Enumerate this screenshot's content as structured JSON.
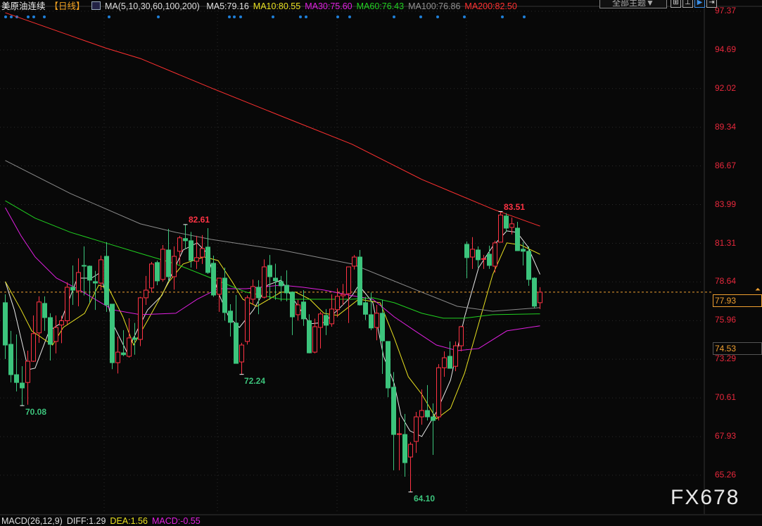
{
  "header": {
    "title": "美原油连续",
    "period": "【日线】",
    "ma_params": "MA(5,10,30,60,100,200)",
    "ma_values": [
      {
        "label": "MA5:79.16",
        "color": "#e0e0e0"
      },
      {
        "label": "MA10:80.55",
        "color": "#e8e020"
      },
      {
        "label": "MA30:75.60",
        "color": "#e020e0"
      },
      {
        "label": "MA60:76.43",
        "color": "#20d020"
      },
      {
        "label": "MA100:76.86",
        "color": "#909090"
      },
      {
        "label": "MA200:82.50",
        "color": "#ff3030"
      }
    ],
    "theme_button": "全部主题▼",
    "tools": [
      "⊞",
      "⊥",
      "▶",
      "⇥"
    ]
  },
  "price_axis": {
    "ticks": [
      "97.37",
      "94.69",
      "92.02",
      "89.34",
      "86.67",
      "83.99",
      "81.31",
      "78.64",
      "75.96",
      "73.29",
      "70.61",
      "67.93",
      "65.26"
    ],
    "current_price": "77.93",
    "reference_price": "74.53"
  },
  "annotations": {
    "low1": "70.08",
    "low2": "72.24",
    "low3": "64.10",
    "high1": "82.61",
    "high2": "83.51"
  },
  "watermark": "FX678",
  "macd": {
    "params": "MACD(26,12,9)",
    "diff": "DIFF:1.29",
    "dea": "DEA:1.56",
    "macd": "MACD:-0.55"
  },
  "colors": {
    "up": "#ff3344",
    "down": "#3cc47c",
    "background": "#080808",
    "axis_label": "#e8283c",
    "current": "#f0a030"
  },
  "chart_data": {
    "type": "candlestick",
    "title": "美原油连续【日线】",
    "ylim": [
      64.0,
      97.37
    ],
    "ohlc": [
      [
        77.2,
        77.78,
        73.3,
        74.27
      ],
      [
        74.32,
        75.25,
        71.68,
        72.22
      ],
      [
        72.22,
        75.0,
        71.06,
        71.68
      ],
      [
        71.64,
        72.81,
        70.08,
        71.3
      ],
      [
        71.68,
        73.88,
        70.14,
        73.15
      ],
      [
        73.15,
        76.32,
        73.1,
        75.06
      ],
      [
        75.11,
        77.64,
        74.42,
        77.25
      ],
      [
        77.15,
        77.64,
        75.25,
        76.17
      ],
      [
        76.17,
        76.47,
        73.2,
        74.32
      ],
      [
        74.52,
        76.32,
        73.69,
        75.49
      ],
      [
        75.66,
        76.3,
        74.4,
        75.95
      ],
      [
        75.95,
        78.6,
        75.7,
        78.27
      ],
      [
        78.27,
        79.78,
        77.05,
        78.07
      ],
      [
        78.02,
        80.27,
        76.95,
        79.29
      ],
      [
        79.78,
        81.1,
        77.7,
        79.73
      ],
      [
        79.73,
        79.78,
        77.2,
        78.76
      ],
      [
        78.66,
        79.4,
        76.7,
        78.56
      ],
      [
        78.56,
        80.46,
        78.07,
        80.17
      ],
      [
        80.41,
        81.39,
        76.57,
        77.05
      ],
      [
        77.1,
        77.1,
        72.6,
        73.05
      ],
      [
        73.05,
        74.85,
        72.3,
        73.78
      ],
      [
        73.73,
        75.3,
        73.5,
        73.6
      ],
      [
        73.49,
        76.12,
        73.4,
        74.76
      ],
      [
        74.76,
        75.8,
        73.6,
        74.66
      ],
      [
        74.66,
        77.6,
        74.2,
        77.54
      ],
      [
        77.54,
        79.05,
        77.05,
        78.07
      ],
      [
        78.22,
        80.02,
        77.9,
        79.88
      ],
      [
        79.98,
        80.12,
        78.41,
        78.71
      ],
      [
        78.81,
        81.19,
        78.66,
        80.9
      ],
      [
        80.85,
        82.31,
        78.66,
        79.0
      ],
      [
        79.0,
        81.1,
        78.1,
        80.41
      ],
      [
        80.76,
        81.83,
        79.83,
        81.69
      ],
      [
        81.64,
        82.61,
        80.9,
        81.49
      ],
      [
        81.49,
        82.1,
        79.63,
        80.12
      ],
      [
        80.07,
        81.83,
        79.54,
        80.32
      ],
      [
        80.36,
        81.88,
        79.88,
        80.95
      ],
      [
        81.05,
        82.36,
        79.2,
        79.29
      ],
      [
        79.93,
        80.46,
        77.6,
        77.73
      ],
      [
        77.78,
        78.9,
        76.57,
        78.9
      ],
      [
        78.9,
        79.63,
        75.96,
        76.52
      ],
      [
        76.62,
        77.1,
        74.86,
        75.84
      ],
      [
        75.79,
        77.73,
        73.0,
        73.0
      ],
      [
        73.1,
        74.42,
        72.24,
        74.27
      ],
      [
        74.52,
        77.7,
        74.3,
        77.54
      ],
      [
        77.44,
        78.8,
        77.05,
        78.32
      ],
      [
        78.27,
        78.76,
        76.4,
        77.54
      ],
      [
        77.58,
        80.2,
        77.5,
        79.68
      ],
      [
        79.78,
        80.5,
        77.4,
        79.0
      ],
      [
        78.9,
        79.9,
        77.4,
        78.71
      ],
      [
        78.66,
        79.05,
        77.3,
        78.37
      ],
      [
        78.41,
        79.44,
        77.3,
        77.88
      ],
      [
        77.93,
        77.98,
        74.96,
        76.22
      ],
      [
        76.37,
        77.4,
        75.96,
        77.05
      ],
      [
        77.25,
        78.07,
        75.6,
        76.08
      ],
      [
        75.96,
        76.4,
        73.7,
        73.73
      ],
      [
        73.78,
        76.1,
        73.7,
        75.54
      ],
      [
        75.49,
        76.57,
        74.03,
        76.42
      ],
      [
        76.32,
        76.76,
        74.96,
        75.64
      ],
      [
        75.74,
        77.78,
        75.54,
        76.76
      ],
      [
        76.72,
        78.2,
        76.2,
        77.64
      ],
      [
        77.68,
        78.5,
        77.05,
        77.78
      ],
      [
        77.83,
        79.68,
        75.8,
        79.68
      ],
      [
        79.73,
        80.5,
        79.5,
        80.36
      ],
      [
        80.36,
        80.85,
        77.0,
        77.05
      ],
      [
        77.2,
        77.6,
        76.0,
        76.4
      ],
      [
        76.37,
        77.9,
        75.3,
        75.45
      ],
      [
        75.49,
        77.05,
        74.6,
        76.47
      ],
      [
        76.47,
        77.4,
        72.27,
        74.56
      ],
      [
        74.52,
        74.52,
        70.66,
        71.3
      ],
      [
        71.35,
        72.4,
        65.6,
        68.08
      ],
      [
        68.08,
        69.25,
        65.6,
        68.13
      ],
      [
        68.08,
        69.5,
        65.16,
        66.13
      ],
      [
        66.52,
        67.56,
        64.1,
        67.4
      ],
      [
        67.6,
        69.64,
        66.81,
        69.3
      ],
      [
        69.3,
        71.2,
        68.76,
        69.74
      ],
      [
        69.74,
        71.5,
        69.05,
        69.3
      ],
      [
        69.3,
        70.23,
        66.67,
        69.05
      ],
      [
        69.3,
        72.95,
        69.05,
        72.7
      ],
      [
        72.7,
        73.83,
        72.07,
        73.39
      ],
      [
        73.49,
        74.52,
        72.66,
        72.66
      ],
      [
        72.8,
        74.52,
        72.46,
        74.22
      ],
      [
        74.22,
        75.6,
        73.83,
        75.54
      ],
      [
        81.24,
        81.44,
        78.9,
        80.32
      ],
      [
        80.36,
        81.74,
        79.54,
        80.9
      ],
      [
        80.85,
        81.1,
        79.63,
        80.17
      ],
      [
        80.2,
        80.5,
        79.54,
        80.25
      ],
      [
        80.56,
        81.15,
        79.54,
        79.78
      ],
      [
        79.73,
        81.49,
        79.29,
        81.34
      ],
      [
        81.39,
        83.51,
        81.39,
        83.27
      ],
      [
        83.2,
        83.4,
        82.1,
        82.36
      ],
      [
        82.41,
        83.1,
        81.93,
        82.66
      ],
      [
        82.36,
        82.8,
        80.8,
        80.8
      ],
      [
        80.9,
        81.4,
        79.78,
        80.76
      ],
      [
        80.76,
        81.1,
        78.37,
        78.81
      ],
      [
        78.9,
        78.96,
        76.8,
        76.96
      ],
      [
        77.2,
        78.27,
        76.76,
        77.93
      ]
    ],
    "ohlc_fields": [
      "open",
      "high",
      "low",
      "close"
    ],
    "moving_averages": [
      {
        "name": "MA5",
        "color": "#e8e8e8",
        "points": [
          [
            0,
            78.66
          ],
          [
            1.6,
            76.71
          ],
          [
            4.1,
            72.57
          ],
          [
            5.3,
            72.67
          ],
          [
            7.8,
            75.25
          ],
          [
            9.7,
            75.74
          ],
          [
            12.8,
            78.9
          ],
          [
            15.3,
            78.9
          ],
          [
            16.9,
            79.29
          ],
          [
            19.1,
            75.74
          ],
          [
            21.6,
            73.79
          ],
          [
            23.4,
            75.25
          ],
          [
            25.3,
            76.71
          ],
          [
            27.8,
            77.69
          ],
          [
            31.6,
            80.85
          ],
          [
            34.1,
            81.34
          ],
          [
            35.9,
            80.61
          ],
          [
            37.8,
            77.93
          ],
          [
            39.7,
            76.22
          ],
          [
            41.6,
            75.49
          ],
          [
            44.1,
            76.71
          ],
          [
            46.6,
            78.42
          ],
          [
            49,
            78.76
          ],
          [
            51.6,
            77.2
          ],
          [
            54.1,
            75.74
          ],
          [
            56.6,
            75.83
          ],
          [
            59.1,
            76.71
          ],
          [
            61.6,
            77.69
          ],
          [
            62.8,
            78.42
          ],
          [
            65.3,
            77.2
          ],
          [
            67.2,
            73.5
          ],
          [
            69.1,
            71.59
          ],
          [
            70.3,
            69.4
          ],
          [
            71.9,
            68.33
          ],
          [
            74,
            67.94
          ],
          [
            76.6,
            69.64
          ],
          [
            79.1,
            71.84
          ],
          [
            81.6,
            76.22
          ],
          [
            84.1,
            79.63
          ],
          [
            86.6,
            81.1
          ],
          [
            89.1,
            82.17
          ],
          [
            90.9,
            82.07
          ],
          [
            92.8,
            81.1
          ],
          [
            95,
            79.16
          ]
        ]
      },
      {
        "name": "MA10",
        "color": "#e8e020",
        "points": [
          [
            0,
            78.66
          ],
          [
            2.8,
            76.71
          ],
          [
            4.7,
            75.25
          ],
          [
            8.4,
            74.27
          ],
          [
            10.3,
            75.49
          ],
          [
            14.1,
            76.47
          ],
          [
            16.6,
            78.42
          ],
          [
            18.4,
            78.17
          ],
          [
            20.9,
            76.22
          ],
          [
            22.8,
            74.27
          ],
          [
            25.3,
            75.98
          ],
          [
            29.1,
            78.66
          ],
          [
            31.6,
            79.88
          ],
          [
            35.3,
            80.37
          ],
          [
            37.8,
            80.12
          ],
          [
            40.3,
            78.66
          ],
          [
            42.2,
            77.44
          ],
          [
            44.7,
            76.95
          ],
          [
            49,
            77.93
          ],
          [
            51.6,
            77.93
          ],
          [
            54.1,
            77.44
          ],
          [
            56.6,
            76.47
          ],
          [
            59.1,
            76.32
          ],
          [
            62.8,
            77.44
          ],
          [
            66.6,
            77.2
          ],
          [
            69.1,
            74.76
          ],
          [
            71.6,
            72.08
          ],
          [
            74,
            70.86
          ],
          [
            76.6,
            69.16
          ],
          [
            79.1,
            69.89
          ],
          [
            81.6,
            72.33
          ],
          [
            84.1,
            75.74
          ],
          [
            86.6,
            79.15
          ],
          [
            89.1,
            81.34
          ],
          [
            91.6,
            81.19
          ],
          [
            95,
            80.55
          ]
        ]
      },
      {
        "name": "MA30",
        "color": "#e020e0",
        "points": [
          [
            0,
            83.78
          ],
          [
            2.8,
            81.83
          ],
          [
            5.3,
            80.37
          ],
          [
            9.1,
            78.9
          ],
          [
            12.8,
            78.17
          ],
          [
            19.1,
            76.71
          ],
          [
            24,
            76.37
          ],
          [
            30.3,
            76.47
          ],
          [
            34.1,
            77.44
          ],
          [
            37.8,
            78.17
          ],
          [
            42.8,
            78.17
          ],
          [
            49,
            78.42
          ],
          [
            52.8,
            78.27
          ],
          [
            56.6,
            78.08
          ],
          [
            61.6,
            77.69
          ],
          [
            65.3,
            77.44
          ],
          [
            69.1,
            76.22
          ],
          [
            72.8,
            75.25
          ],
          [
            76.6,
            74.27
          ],
          [
            80.3,
            73.88
          ],
          [
            84.1,
            74.03
          ],
          [
            89.1,
            75.25
          ],
          [
            95,
            75.6
          ]
        ]
      },
      {
        "name": "MA60",
        "color": "#20d020",
        "points": [
          [
            0,
            84.26
          ],
          [
            5.3,
            83.05
          ],
          [
            11.6,
            82.07
          ],
          [
            17.8,
            81.34
          ],
          [
            24,
            80.61
          ],
          [
            30.3,
            79.88
          ],
          [
            36.6,
            78.9
          ],
          [
            42.8,
            77.93
          ],
          [
            49,
            77.44
          ],
          [
            55.3,
            77.44
          ],
          [
            61.6,
            77.44
          ],
          [
            65.3,
            77.54
          ],
          [
            69.1,
            77.2
          ],
          [
            74,
            76.47
          ],
          [
            77.8,
            76.13
          ],
          [
            81.6,
            76.13
          ],
          [
            86.6,
            76.37
          ],
          [
            95,
            76.43
          ]
        ]
      },
      {
        "name": "MA100",
        "color": "#8a8a8a",
        "points": [
          [
            0,
            87.04
          ],
          [
            11.6,
            84.75
          ],
          [
            24,
            82.66
          ],
          [
            30.3,
            82.07
          ],
          [
            36.6,
            81.58
          ],
          [
            49,
            80.85
          ],
          [
            61.6,
            79.88
          ],
          [
            67.8,
            78.9
          ],
          [
            74,
            77.93
          ],
          [
            80.3,
            76.95
          ],
          [
            86.6,
            76.61
          ],
          [
            95,
            76.86
          ]
        ]
      },
      {
        "name": "MA200",
        "color": "#ff3030",
        "points": [
          [
            0,
            97.27
          ],
          [
            11.6,
            95.68
          ],
          [
            17.8,
            94.83
          ],
          [
            24,
            94.1
          ],
          [
            36.6,
            92.06
          ],
          [
            49,
            90.12
          ],
          [
            61.6,
            88.17
          ],
          [
            74,
            85.73
          ],
          [
            86.6,
            83.68
          ],
          [
            95,
            82.5
          ]
        ]
      }
    ]
  }
}
